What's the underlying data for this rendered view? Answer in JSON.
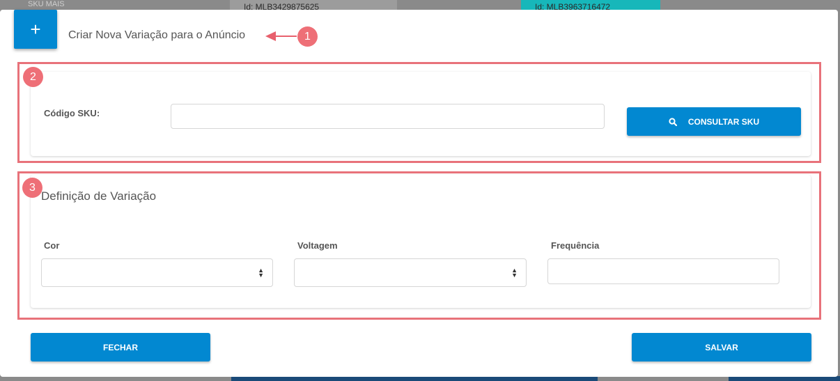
{
  "background": {
    "logo_fragment": "SKU MAIS",
    "card1": "Id: MLB3429875625",
    "card2": "Id: MLB3963716472"
  },
  "modal": {
    "plus_label": "+",
    "title": "Criar Nova Variação para o Anúncio"
  },
  "annotations": {
    "badge1": "1",
    "badge2": "2",
    "badge3": "3",
    "color": "#ee6f77"
  },
  "sku_section": {
    "label": "Código SKU:",
    "input_value": "",
    "button_label": "CONSULTAR SKU",
    "button_icon": "search-icon"
  },
  "variation_section": {
    "title": "Definição de Variação",
    "fields": [
      {
        "label": "Cor",
        "value": "",
        "type": "select"
      },
      {
        "label": "Voltagem",
        "value": "",
        "type": "select"
      },
      {
        "label": "Frequência",
        "value": "",
        "type": "text"
      }
    ]
  },
  "footer": {
    "close_label": "FECHAR",
    "save_label": "SALVAR"
  },
  "colors": {
    "primary": "#0288d1",
    "highlight": "#e8727a"
  }
}
